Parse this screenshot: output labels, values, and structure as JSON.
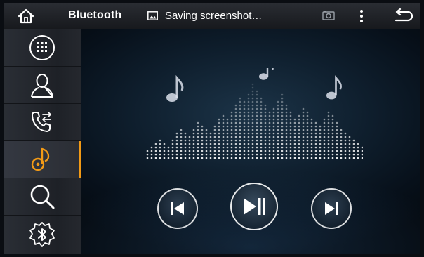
{
  "statusbar": {
    "title": "Bluetooth",
    "notification": "Saving screenshot…",
    "icons": {
      "home": "home-icon",
      "notification": "image-icon",
      "screenshot": "screenshot-icon",
      "menu": "overflow-menu-icon",
      "back": "back-icon"
    }
  },
  "sidebar": {
    "items": [
      {
        "name": "dialpad",
        "icon": "dialpad-icon",
        "active": false
      },
      {
        "name": "contacts",
        "icon": "contact-icon",
        "active": false
      },
      {
        "name": "call-log",
        "icon": "call-transfer-icon",
        "active": false
      },
      {
        "name": "music",
        "icon": "music-note-icon",
        "active": true
      },
      {
        "name": "search",
        "icon": "search-icon",
        "active": false
      },
      {
        "name": "bluetooth-settings",
        "icon": "bluetooth-settings-icon",
        "active": false
      }
    ],
    "accent_color": "#f29a16"
  },
  "player": {
    "controls": [
      {
        "name": "previous",
        "icon": "skip-previous-icon"
      },
      {
        "name": "play-pause",
        "icon": "play-pause-icon"
      },
      {
        "name": "next",
        "icon": "skip-next-icon"
      }
    ]
  },
  "colors": {
    "statusbar_bg": "#1f2227",
    "sidebar_bg": "#23262c",
    "main_bg": "#0f1f2e",
    "accent": "#f29a16",
    "icon": "#ffffff"
  }
}
